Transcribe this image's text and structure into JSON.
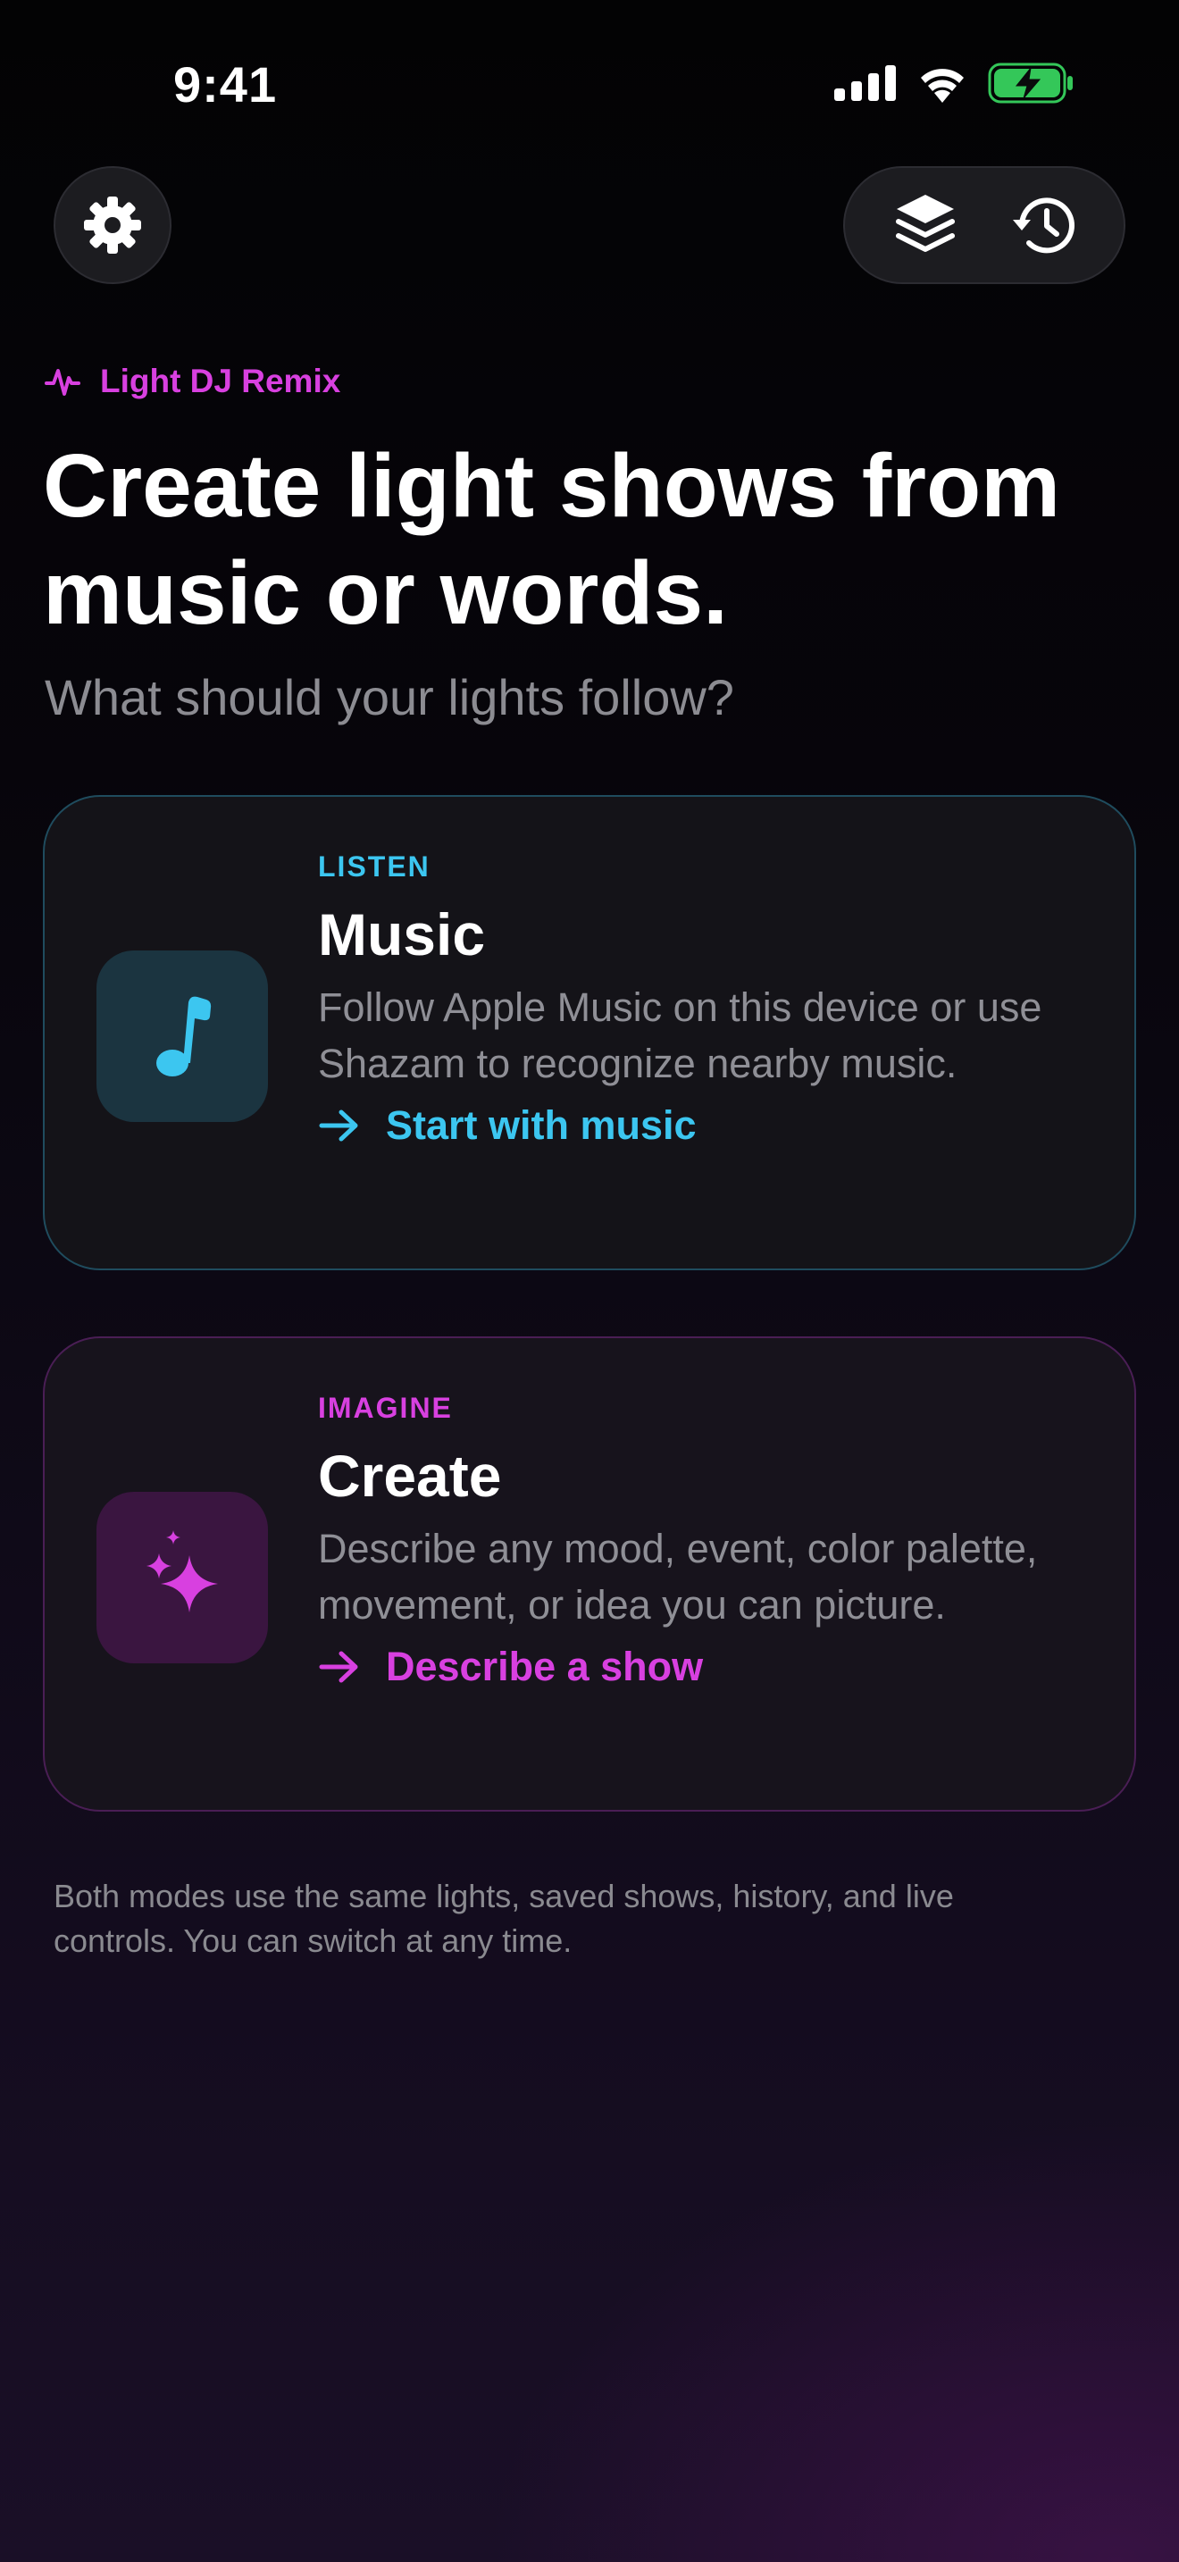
{
  "status_bar": {
    "time": "9:41"
  },
  "header": {
    "brand": "Light DJ Remix",
    "title": "Create light shows from music or words.",
    "subtitle": "What should your lights follow?"
  },
  "modes": [
    {
      "kicker": "LISTEN",
      "title": "Music",
      "description": "Follow Apple Music on this device or use Shazam to recognize nearby music.",
      "action": "Start with music",
      "icon": "music-note-icon",
      "accent": "#3cc6f0"
    },
    {
      "kicker": "IMAGINE",
      "title": "Create",
      "description": "Describe any mood, event, color palette, movement, or idea you can picture.",
      "action": "Describe a show",
      "icon": "sparkles-icon",
      "accent": "#d840e0"
    }
  ],
  "footnote": "Both modes use the same lights, saved shows, history, and live controls. You can switch at any time.",
  "icons": {
    "settings": "gear-icon",
    "saved_shows": "layers-icon",
    "history": "history-icon",
    "battery_color": "#34c759"
  }
}
